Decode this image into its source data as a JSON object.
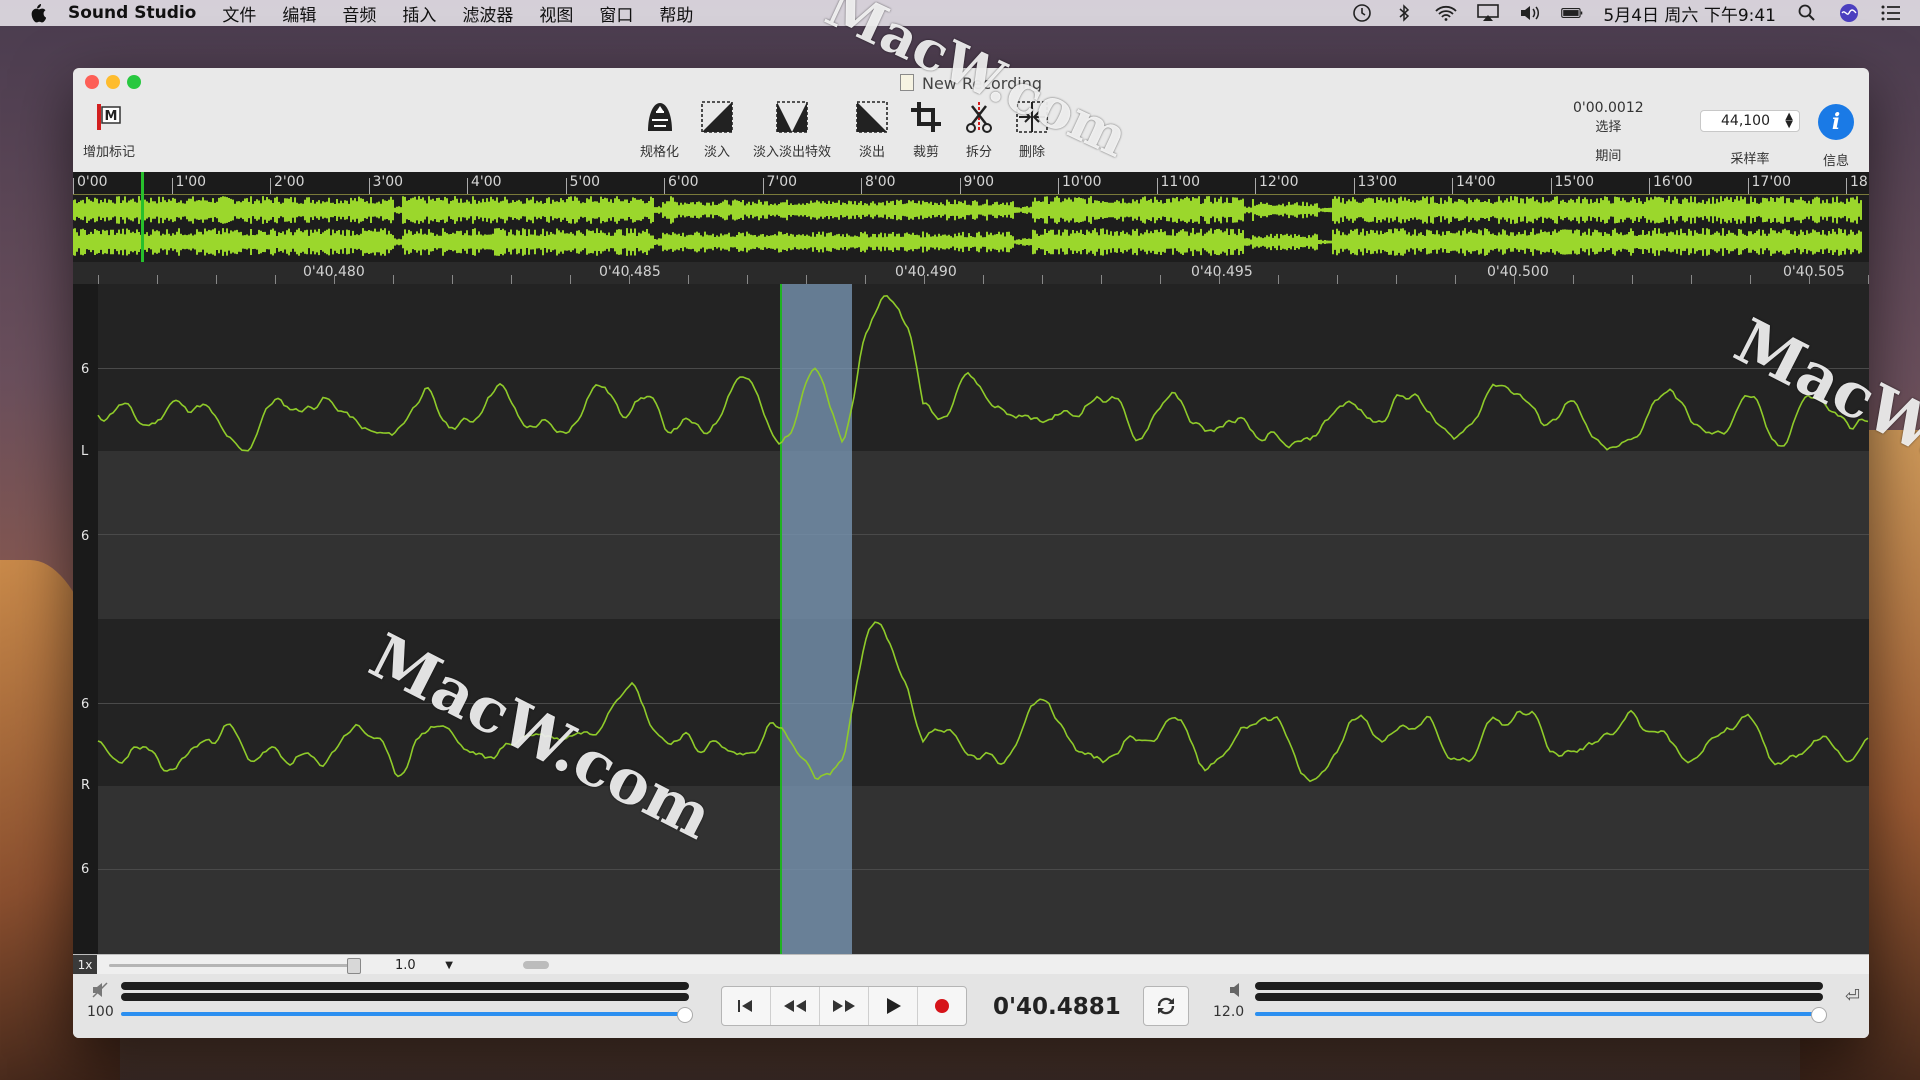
{
  "menubar": {
    "app_name": "Sound Studio",
    "items": [
      "文件",
      "编辑",
      "音频",
      "插入",
      "滤波器",
      "视图",
      "窗口",
      "帮助"
    ],
    "datetime": "5月4日 周六 下午9:41"
  },
  "window": {
    "title": "New Recording"
  },
  "toolbar": {
    "add_marker_label": "增加标记",
    "marker_icon_text": "M",
    "tools": [
      {
        "label": "规格化",
        "icon": "normalize-icon"
      },
      {
        "label": "淡入",
        "icon": "fade-in-icon"
      },
      {
        "label": "淡入淡出特效",
        "icon": "crossfade-icon"
      },
      {
        "label": "淡出",
        "icon": "fade-out-icon"
      },
      {
        "label": "裁剪",
        "icon": "crop-icon"
      },
      {
        "label": "拆分",
        "icon": "split-icon"
      },
      {
        "label": "删除",
        "icon": "delete-icon"
      }
    ],
    "duration_value": "0'00.0012",
    "duration_sub": "选择",
    "duration_label": "期间",
    "sample_rate_value": "44,100",
    "sample_rate_label": "采样率",
    "info_label": "信息"
  },
  "overview_ruler": [
    "0'00",
    "1'00",
    "2'00",
    "3'00",
    "4'00",
    "5'00",
    "6'00",
    "7'00",
    "8'00",
    "9'00",
    "10'00",
    "11'00",
    "12'00",
    "13'00",
    "14'00",
    "15'00",
    "16'00",
    "17'00",
    "18"
  ],
  "detail_ruler": [
    "0'40.480",
    "0'40.485",
    "0'40.490",
    "0'40.495",
    "0'40.500",
    "0'40.505"
  ],
  "channels": {
    "left_label": "L",
    "right_label": "R",
    "scale_mark": "6"
  },
  "zoom": {
    "x_label": "1x",
    "value": "1.0"
  },
  "transport": {
    "input_level": "100",
    "time": "0'40.4881",
    "output_level": "12.0"
  },
  "watermark": "MacW.com",
  "colors": {
    "waveform": "#8fcb2a",
    "overview_wave": "#9bd72c",
    "playhead": "#22bb22",
    "accent_blue": "#2b8ff0"
  }
}
